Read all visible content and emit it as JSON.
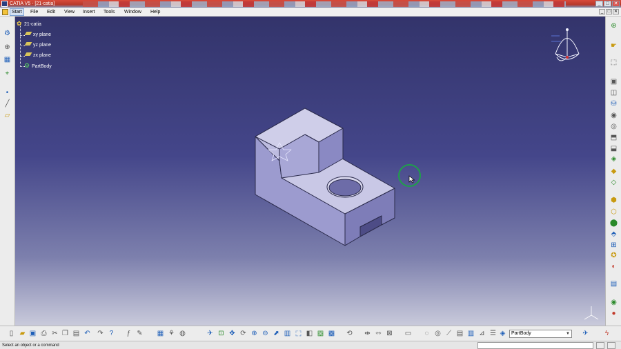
{
  "window": {
    "title": "CATIA V5 - [21-catia]",
    "controls": [
      "_",
      "□",
      "✕"
    ]
  },
  "menubar": {
    "items": [
      "Start",
      "File",
      "Edit",
      "View",
      "Insert",
      "Tools",
      "Window",
      "Help"
    ],
    "active": "Start"
  },
  "tree": {
    "root": "21-catia",
    "children": [
      "xy plane",
      "yz plane",
      "zx plane",
      "PartBody"
    ]
  },
  "toolbar": {
    "current_body": "PartBody"
  },
  "status": {
    "message": "Select an object or a command"
  },
  "colors": {
    "accent": "#1fa04a",
    "model_face": "#c9c8e6"
  }
}
